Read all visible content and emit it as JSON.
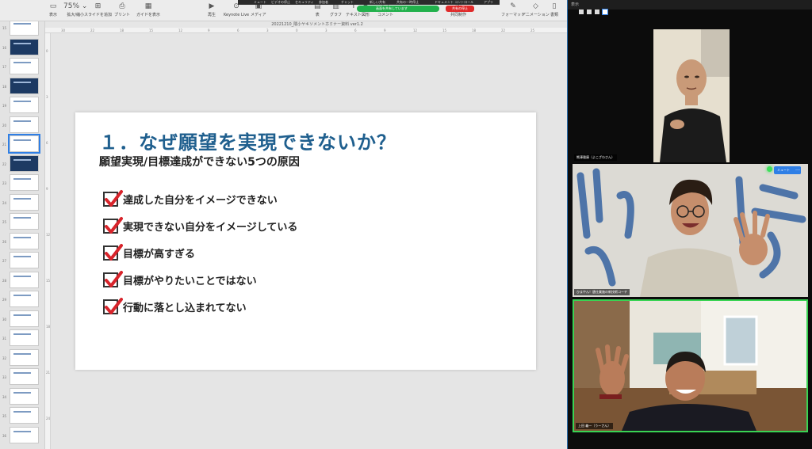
{
  "keynote": {
    "doc_title": "20221210_隈小ヤキソメントホミナー資料 ver1.2",
    "toolbar": [
      {
        "icon": "sidebar-icon",
        "glyph": "▭",
        "label": "表示"
      },
      {
        "icon": "zoom-icon",
        "glyph": "75% ⌄",
        "label": "拡大/縮小"
      },
      {
        "icon": "add-slide-icon",
        "glyph": "⊞",
        "label": "スライドを追加"
      },
      {
        "icon": "print-icon",
        "glyph": "⎙",
        "label": "プリント"
      },
      {
        "icon": "guide-icon",
        "glyph": "▦",
        "label": "ガイドを表示"
      },
      {
        "icon": "play-icon",
        "glyph": "▶",
        "label": "再生"
      },
      {
        "icon": "keynote-live-icon",
        "glyph": "⊙",
        "label": "Keynote Live"
      },
      {
        "icon": "media-icon",
        "glyph": "▣",
        "label": "メディア"
      },
      {
        "icon": "table-icon",
        "glyph": "▤",
        "label": "表"
      },
      {
        "icon": "chart-icon",
        "glyph": "▥",
        "label": "グラフ"
      },
      {
        "icon": "text-icon",
        "glyph": "T",
        "label": "テキスト"
      },
      {
        "icon": "shape-icon",
        "glyph": "◆",
        "label": "図形"
      },
      {
        "icon": "comment-icon",
        "glyph": "▢",
        "label": "コメント"
      },
      {
        "icon": "collaborate-icon",
        "glyph": "◎",
        "label": "共同制作"
      },
      {
        "icon": "format-icon",
        "glyph": "✎",
        "label": "フォーマット"
      },
      {
        "icon": "animate-icon",
        "glyph": "◇",
        "label": "アニメーション"
      },
      {
        "icon": "document-icon",
        "glyph": "▯",
        "label": "書類"
      }
    ],
    "zoom_menu": [
      "ミュート",
      "ビデオの停止",
      "セキュリティ",
      "参加者",
      "チャット",
      "新しい共有",
      "共有の一時停止",
      "ドキュメント コントロール",
      "アプリ"
    ],
    "share_status": "画面を共有しています",
    "stop_share": "共有の停止",
    "ruler_top": [
      "30",
      "22",
      "18",
      "15",
      "12",
      "9",
      "6",
      "3",
      "0",
      "3",
      "6",
      "9",
      "12",
      "15",
      "18",
      "22",
      "25"
    ],
    "ruler_left": [
      "0",
      "3",
      "6",
      "9",
      "12",
      "15",
      "18",
      "21",
      "24"
    ],
    "slide_numbers": [
      "15",
      "16",
      "17",
      "18",
      "19",
      "20",
      "21",
      "22",
      "23",
      "24",
      "25",
      "26",
      "27",
      "28",
      "29",
      "30",
      "31",
      "32",
      "33",
      "34",
      "35",
      "36"
    ]
  },
  "slide": {
    "title": "１．なぜ願望を実現できないか？",
    "subtitle": "願望実現/目標達成ができない5つの原因",
    "reasons": [
      "達成した自分をイメージできない",
      "実現できない自分をイメージしている",
      "目標が高すぎる",
      "目標がやりたいことではない",
      "行動に落とし込まれてない"
    ],
    "title_color": "#1f5f8e",
    "check_color": "#d8242b"
  },
  "zoom": {
    "header": "表示",
    "participants": [
      {
        "name": "熊澤雅康（よこざわさん）"
      },
      {
        "name": "ひまやん！唐仕業施の新技術コーチ"
      },
      {
        "name": "上田 義一（うーさん）"
      }
    ],
    "mute_label": "ミュート",
    "more": "…"
  }
}
